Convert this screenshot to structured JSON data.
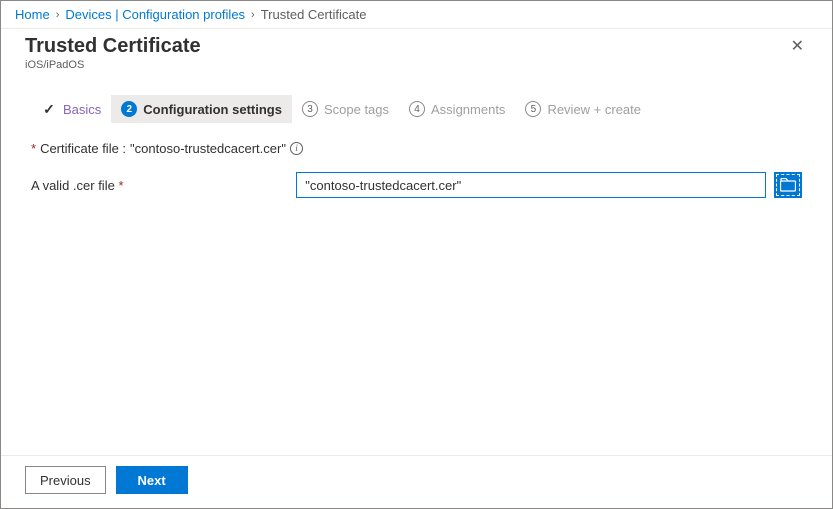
{
  "breadcrumb": {
    "items": [
      {
        "label": "Home"
      },
      {
        "label": "Devices | Configuration profiles"
      },
      {
        "label": "Trusted Certificate"
      }
    ]
  },
  "header": {
    "title": "Trusted Certificate",
    "subtitle": "iOS/iPadOS"
  },
  "steps": {
    "s1": {
      "label": "Basics"
    },
    "s2": {
      "num": "2",
      "label": "Configuration settings"
    },
    "s3": {
      "num": "3",
      "label": "Scope tags"
    },
    "s4": {
      "num": "4",
      "label": "Assignments"
    },
    "s5": {
      "num": "5",
      "label": "Review + create"
    }
  },
  "form": {
    "cert_file_label_prefix": "Certificate file : ",
    "cert_file_name": "\"contoso-trustedcacert.cer\"",
    "valid_label": "A valid .cer file",
    "valid_value": "\"contoso-trustedcacert.cer\""
  },
  "footer": {
    "previous": "Previous",
    "next": "Next"
  }
}
